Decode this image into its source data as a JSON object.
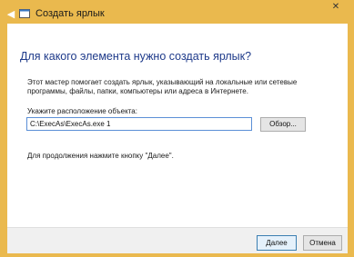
{
  "window": {
    "title": "Создать ярлык",
    "close_glyph": "✕",
    "back_glyph": "◀"
  },
  "wizard": {
    "heading": "Для какого элемента нужно создать ярлык?",
    "description": "Этот мастер помогает создать ярлык, указывающий на локальные или сетевые программы, файлы, папки, компьютеры или адреса в Интернете.",
    "location_label": "Укажите расположение объекта:",
    "location_value": "C:\\ExecAs\\ExecAs.exe 1",
    "browse_label": "Обзор...",
    "hint": "Для продолжения нажмите кнопку \"Далее\"."
  },
  "footer": {
    "next_label": "Далее",
    "cancel_label": "Отмена"
  },
  "colors": {
    "frame": "#eab94e",
    "heading": "#1e3a8a",
    "input_border": "#5b8fd6"
  }
}
